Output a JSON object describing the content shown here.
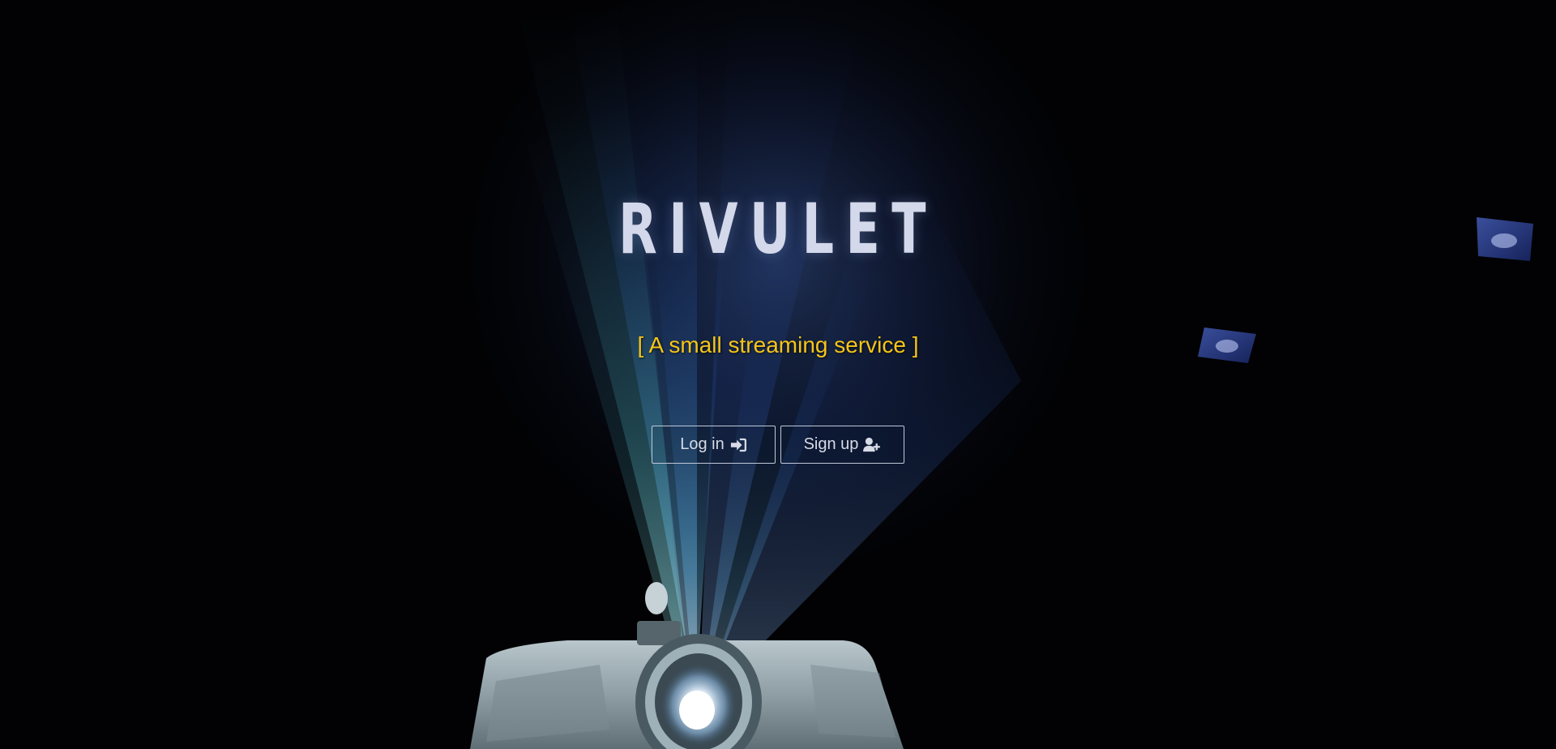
{
  "hero": {
    "title": "RIVULET",
    "tagline": "[ A small streaming service ]"
  },
  "actions": {
    "login_label": "Log in",
    "login_icon": "sign-in-icon",
    "signup_label": "Sign up",
    "signup_icon": "user-plus-icon"
  },
  "colors": {
    "background": "#020204",
    "title": "#d3d8ea",
    "tagline": "#f5c518",
    "button_text": "#d6dbe6",
    "button_border": "#c0c8d8"
  }
}
